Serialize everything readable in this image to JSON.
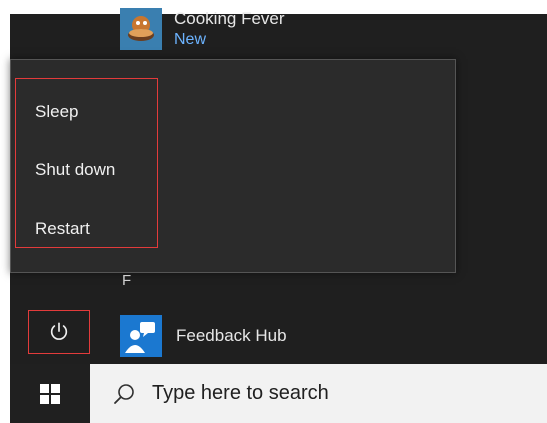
{
  "apps": {
    "cooking": {
      "name": "Cooking Fever",
      "status": "New",
      "icon": "cooking-fever-icon"
    },
    "section_letter": "F",
    "feedback": {
      "name": "Feedback Hub",
      "icon": "feedback-hub-icon"
    }
  },
  "power_menu": {
    "items": [
      {
        "label": "Sleep"
      },
      {
        "label": "Shut down"
      },
      {
        "label": "Restart"
      }
    ],
    "highlight_color": "#e23b3b"
  },
  "power_button": {
    "icon": "power-icon"
  },
  "taskbar": {
    "start_icon": "windows-start-icon",
    "search": {
      "placeholder": "Type here to search",
      "icon": "search-icon"
    }
  }
}
